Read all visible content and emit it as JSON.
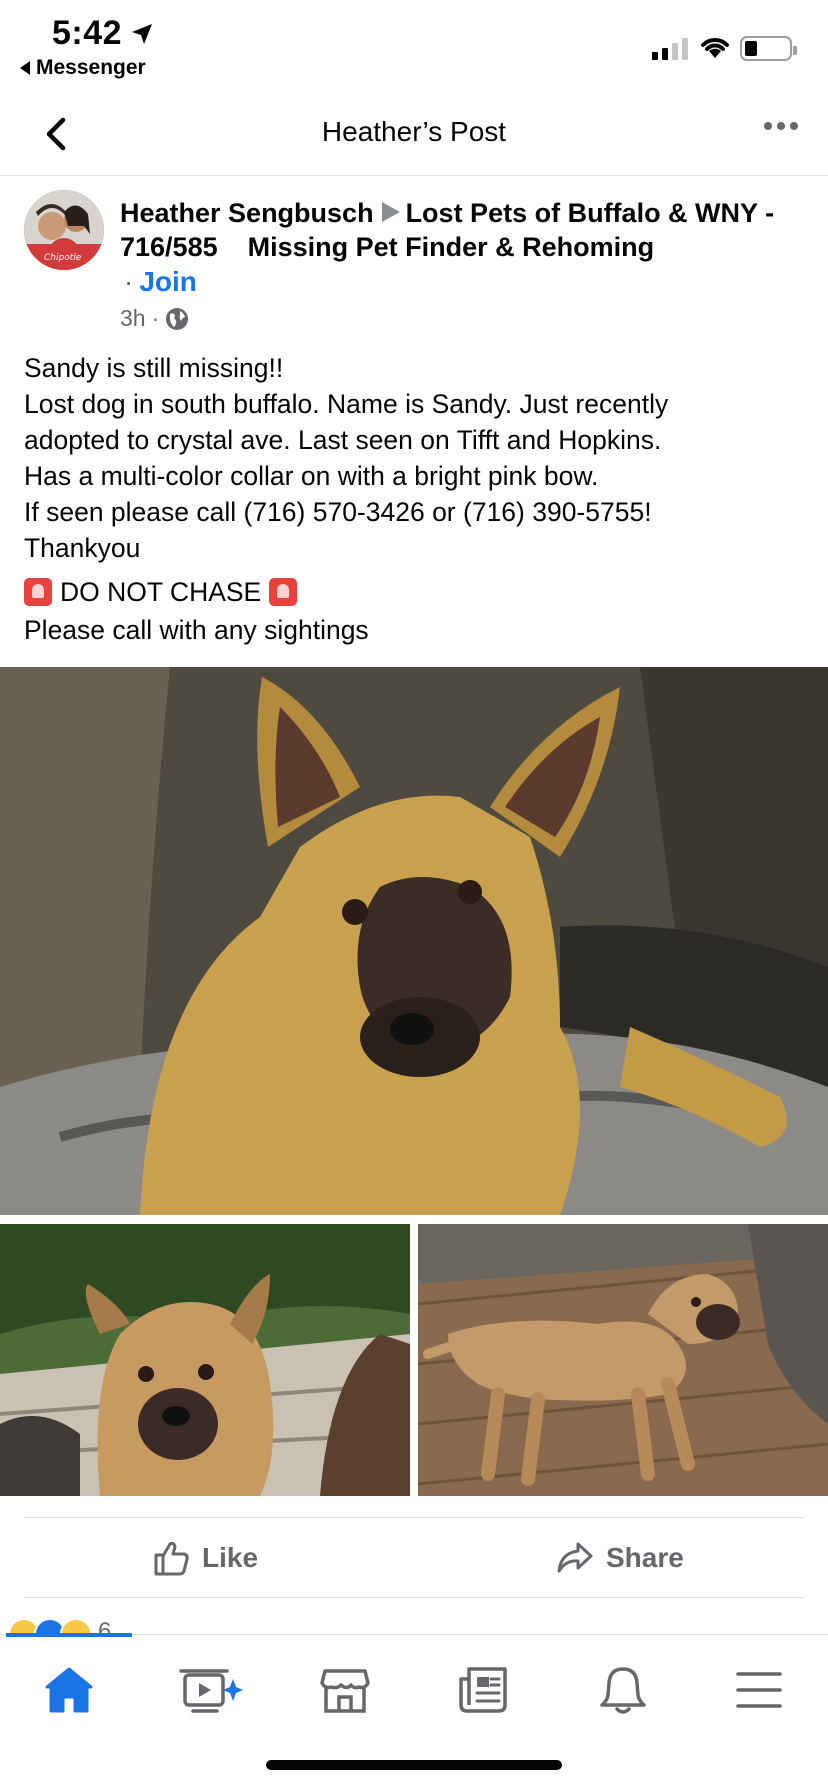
{
  "status_bar": {
    "time": "5:42",
    "back_app": "Messenger"
  },
  "nav": {
    "title": "Heather’s Post"
  },
  "post": {
    "author": "Heather Sengbusch",
    "group": "Lost Pets of Buffalo & WNY - 716/585    Missing Pet Finder & Rehoming",
    "join_label": "Join",
    "time_ago": "3h",
    "body_lines": [
      "Sandy is still missing!!",
      "Lost dog in south buffalo. Name is Sandy. Just recently",
      "adopted to crystal ave. Last seen on Tifft and Hopkins.",
      "Has a multi-color collar on with a bright pink bow.",
      "If seen please call (716) 570-3426 or (716) 390-5755!",
      "Thankyou"
    ],
    "alert_text": "DO NOT CHASE",
    "call_text": "Please call with any sightings",
    "reaction_count": "6"
  },
  "actions": {
    "like_label": "Like",
    "share_label": "Share"
  },
  "icons": {
    "home": "home-icon",
    "watch": "video-icon",
    "marketplace": "marketplace-icon",
    "news": "news-icon",
    "notifications": "bell-icon",
    "menu": "menu-icon"
  },
  "colors": {
    "accent": "#1b74e4",
    "muted": "#65676b",
    "divider": "#dadde1"
  }
}
